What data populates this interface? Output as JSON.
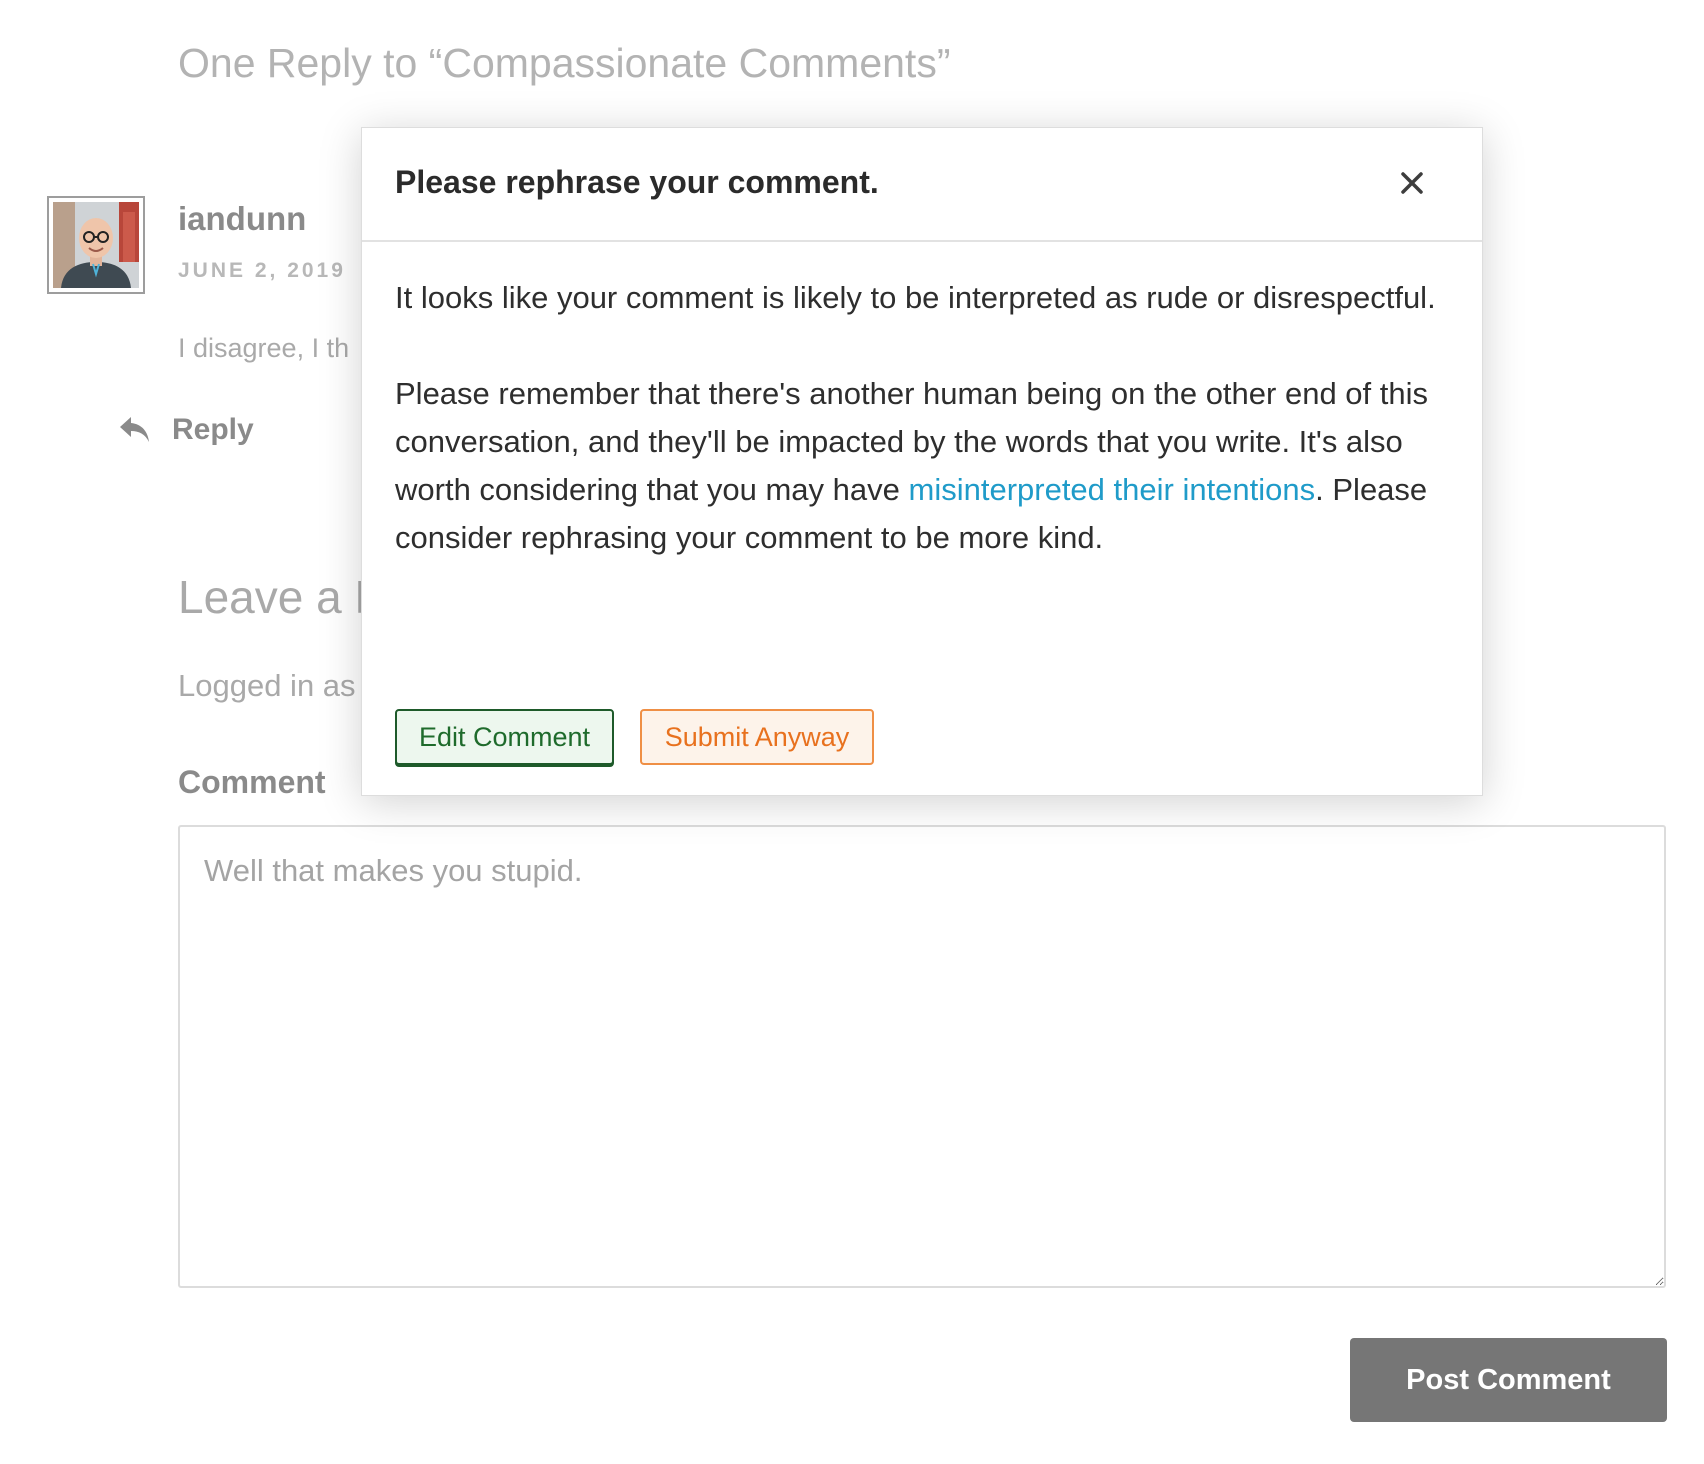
{
  "comments": {
    "title": "One Reply to “Compassionate Comments”",
    "items": [
      {
        "author": "iandunn",
        "date": "JUNE 2, 2019",
        "text": "I disagree, I th",
        "reply_label": "Reply"
      }
    ]
  },
  "respond": {
    "title": "Leave a R",
    "logged_in_text": "Logged in as",
    "comment_label": "Comment",
    "comment_value": "Well that makes you stupid.",
    "submit_label": "Post Comment"
  },
  "modal": {
    "title": "Please rephrase your comment.",
    "paragraph1": "It looks like your comment is likely to be interpreted as rude or disrespectful.",
    "paragraph2_before": "Please remember that there's another human being on the other end of this conversation, and they'll be impacted by the words that you write. It's also worth considering that you may have ",
    "paragraph2_link": "misinterpreted their intentions",
    "paragraph2_after": ". Please consider rephrasing your comment to be more kind.",
    "edit_button": "Edit Comment",
    "submit_button": "Submit Anyway"
  },
  "icons": {
    "close": "close-icon",
    "reply": "reply-arrow-icon",
    "avatar": "avatar"
  },
  "colors": {
    "link": "#1f9bc9",
    "edit_border": "#1e5a2a",
    "submit_accent": "#e8711e",
    "post_button_bg": "#767676"
  }
}
